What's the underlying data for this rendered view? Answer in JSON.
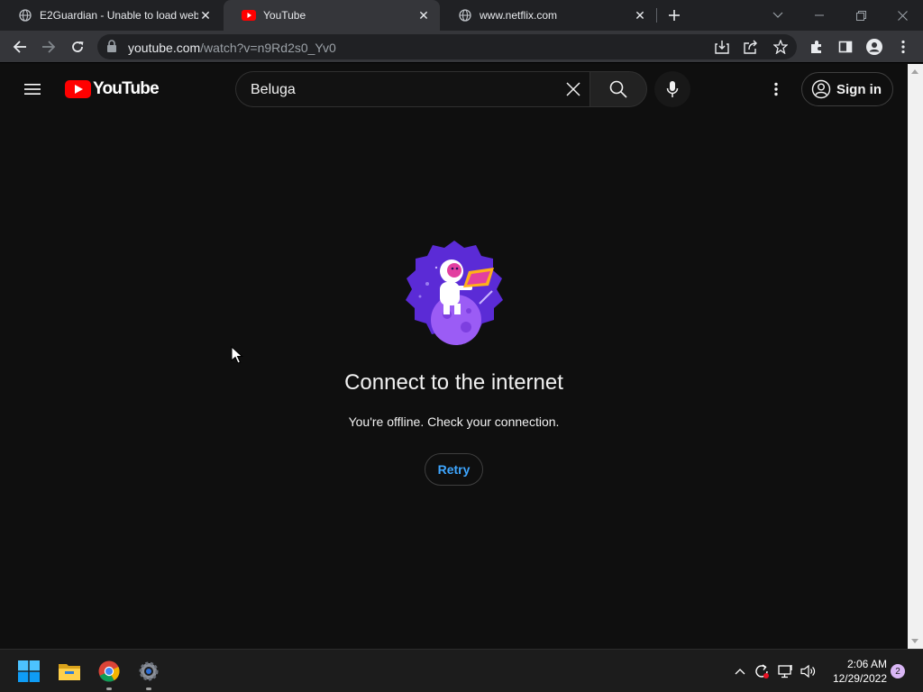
{
  "browser": {
    "tabs": [
      {
        "title": "E2Guardian - Unable to load web",
        "icon": "globe-icon",
        "active": false
      },
      {
        "title": "YouTube",
        "icon": "youtube-favicon",
        "active": true
      },
      {
        "title": "www.netflix.com",
        "icon": "globe-icon",
        "active": false
      }
    ],
    "address": {
      "host": "youtube.com",
      "path": "/watch?v=n9Rd2s0_Yv0"
    }
  },
  "youtube": {
    "logo_text": "YouTube",
    "search": {
      "query": "Beluga"
    },
    "signin_label": "Sign in",
    "offline": {
      "title": "Connect to the internet",
      "message": "You're offline. Check your connection.",
      "retry_label": "Retry"
    }
  },
  "taskbar": {
    "time": "2:06 AM",
    "date": "12/29/2022",
    "notification_count": "2",
    "apps": [
      "windows-start-icon",
      "file-explorer-icon",
      "chrome-icon",
      "settings-icon"
    ]
  },
  "colors": {
    "accent_blue": "#3ea6ff",
    "yt_red": "#ff0000",
    "page_bg": "#0f0f0f"
  }
}
